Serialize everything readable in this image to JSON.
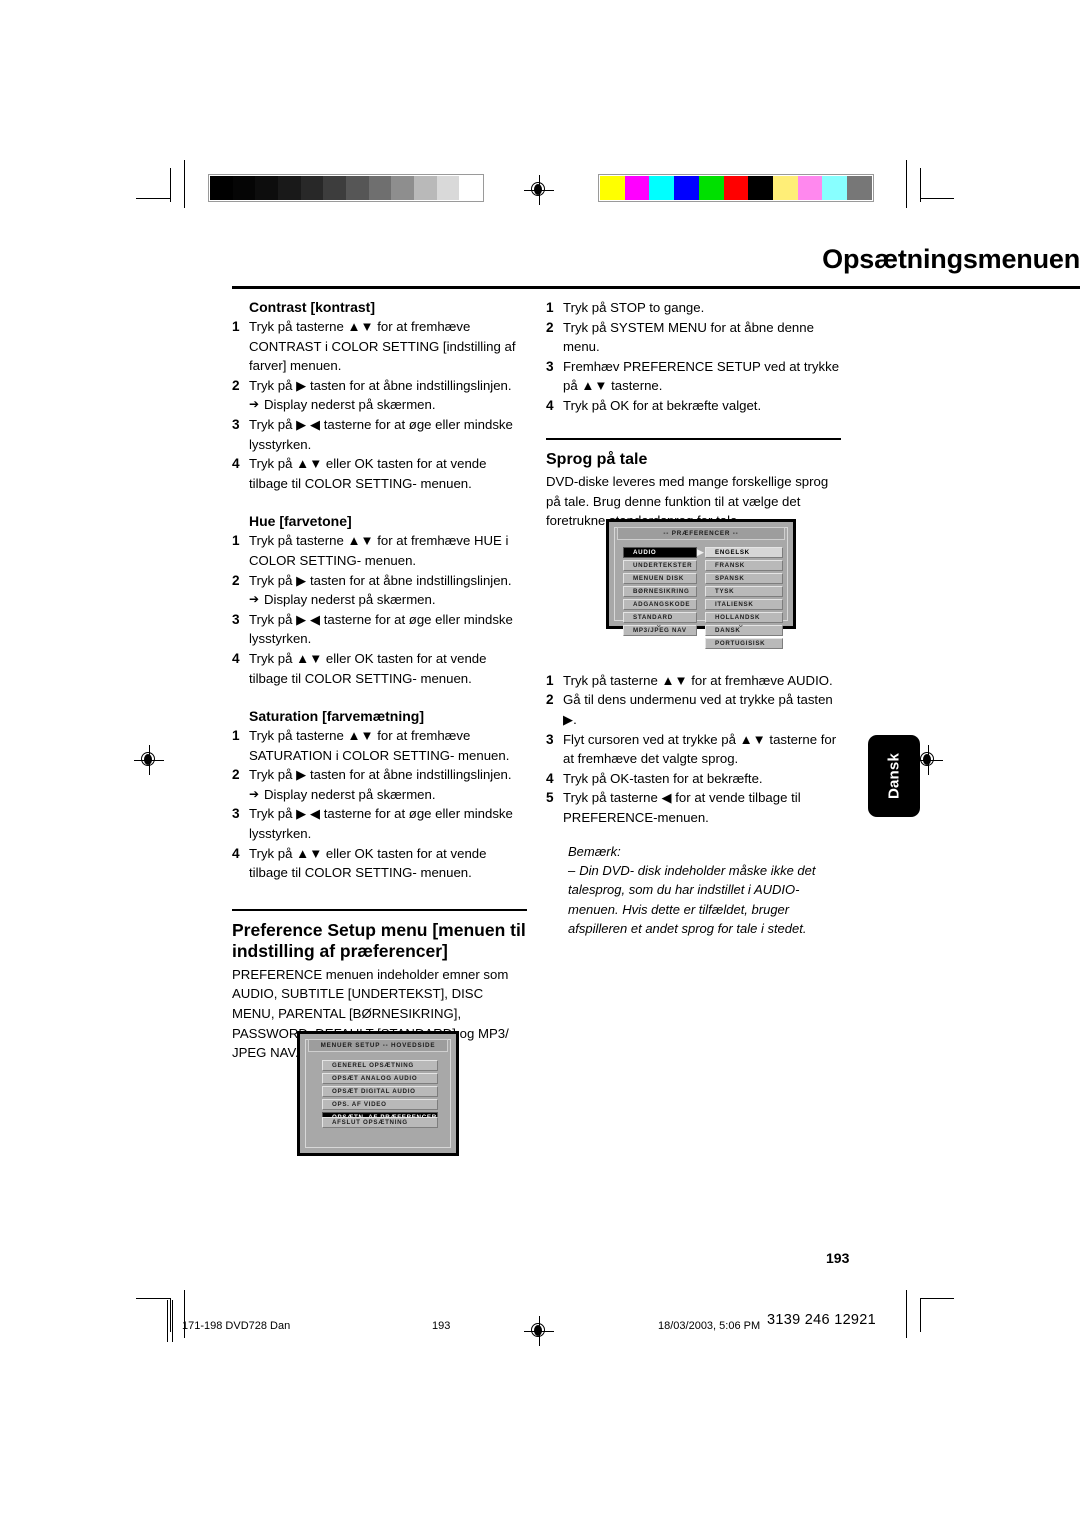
{
  "page": {
    "title": "Opsætningsmenuen",
    "number": "193",
    "side_tab": "Dansk"
  },
  "top_bars": {
    "gray_strip": [
      "#000000",
      "#050505",
      "#0d0d0d",
      "#191919",
      "#282828",
      "#3d3d3d",
      "#565656",
      "#6f6f6f",
      "#8e8e8e",
      "#b9b9b9",
      "#d9d9d9",
      "#ffffff"
    ],
    "color_strip": [
      "#ffff00",
      "#ff00ff",
      "#00ffff",
      "#0000ff",
      "#00e000",
      "#ff0000",
      "#000000",
      "#ffee77",
      "#ff88ee",
      "#88ffff",
      "#777777"
    ]
  },
  "left_column": {
    "contrast": {
      "heading": "Contrast [kontrast]",
      "steps": [
        {
          "num": "1",
          "text": "Tryk på tasterne ▲▼ for at fremhæve CONTRAST i COLOR SETTING [indstilling af farver] menuen."
        },
        {
          "num": "2",
          "text": "Tryk på ▶ tasten for at åbne indstillingslinjen.",
          "sub": "Display nederst på skærmen."
        },
        {
          "num": "3",
          "text": "Tryk på ▶ ◀ tasterne for at øge eller mindske lysstyrken."
        },
        {
          "num": "4",
          "text": "Tryk på ▲▼ eller OK tasten for at vende tilbage til COLOR SETTING- menuen."
        }
      ]
    },
    "hue": {
      "heading": "Hue [farvetone]",
      "steps": [
        {
          "num": "1",
          "text": "Tryk på tasterne ▲▼ for at fremhæve HUE i COLOR SETTING- menuen."
        },
        {
          "num": "2",
          "text": "Tryk på ▶ tasten for at åbne indstillingslinjen.",
          "sub": "Display nederst på skærmen."
        },
        {
          "num": "3",
          "text": "Tryk på ▶ ◀ tasterne for at øge eller mindske lysstyrken."
        },
        {
          "num": "4",
          "text": "Tryk på ▲▼ eller OK tasten for at vende tilbage til COLOR SETTING- menuen."
        }
      ]
    },
    "saturation": {
      "heading": "Saturation [farvemætning]",
      "steps": [
        {
          "num": "1",
          "text": "Tryk på tasterne ▲▼ for at fremhæve SATURATION i COLOR SETTING- menuen."
        },
        {
          "num": "2",
          "text": "Tryk på ▶ tasten for at åbne indstillingslinjen.",
          "sub": "Display nederst på skærmen."
        },
        {
          "num": "3",
          "text": "Tryk på ▶ ◀ tasterne for at øge eller mindske lysstyrken."
        },
        {
          "num": "4",
          "text": "Tryk på ▲▼ eller OK tasten for at vende tilbage til COLOR SETTING- menuen."
        }
      ]
    },
    "preference_setup": {
      "heading": "Preference Setup menu [menuen til indstilling af præferencer]",
      "body": "PREFERENCE menuen indeholder emner som AUDIO, SUBTITLE [UNDERTEKST], DISC MENU, PARENTAL [BØRNESIKRING], PASSWORD, DEFAULT [STANDARD] og MP3/ JPEG NAV."
    }
  },
  "right_column": {
    "setup_steps": [
      {
        "num": "1",
        "text": "Tryk på STOP to gange."
      },
      {
        "num": "2",
        "text": "Tryk på SYSTEM MENU for at åbne denne menu."
      },
      {
        "num": "3",
        "text": "Fremhæv PREFERENCE SETUP ved at trykke på ▲▼ tasterne."
      },
      {
        "num": "4",
        "text": "Tryk på OK for at bekræfte valget."
      }
    ],
    "sprog": {
      "heading": "Sprog på tale",
      "body": "DVD-diske leveres med mange forskellige sprog på tale. Brug denne funktion til at vælge det foretrukne standardsprog for tale."
    },
    "audio_steps": [
      {
        "num": "1",
        "text": "Tryk på tasterne ▲▼ for at fremhæve AUDIO."
      },
      {
        "num": "2",
        "text": "Gå til dens undermenu ved at trykke på tasten ▶."
      },
      {
        "num": "3",
        "text": "Flyt cursoren ved at trykke på ▲▼ tasterne for at fremhæve det valgte sprog."
      },
      {
        "num": "4",
        "text": "Tryk på OK-tasten for at bekræfte."
      },
      {
        "num": "5",
        "text": "Tryk på tasterne ◀ for at vende tilbage til PREFERENCE-menuen."
      }
    ],
    "note": {
      "title": "Bemærk:",
      "dash": "–",
      "text": "Din DVD- disk indeholder måske ikke det talesprog, som du har indstillet i AUDIO- menuen. Hvis dette er tilfældet, bruger afspilleren et andet sprog for tale i stedet."
    }
  },
  "osd_main_setup": {
    "title": "MENUER SETUP -- HOVEDSIDE",
    "items": [
      {
        "label": "GENEREL OPSÆTNING",
        "selected": false
      },
      {
        "label": "OPSÆT ANALOG AUDIO",
        "selected": false
      },
      {
        "label": "OPSÆT DIGITAL AUDIO",
        "selected": false
      },
      {
        "label": "OPS. AF VIDEO",
        "selected": false
      },
      {
        "label": "OPSÆTN. AF PRÆFERENCER",
        "selected": true
      }
    ],
    "exit_item": {
      "label": "AFSLUT OPSÆTNING",
      "selected": false
    }
  },
  "osd_preferences": {
    "title": "-- PRÆFERENCER --",
    "left_items": [
      {
        "label": "AUDIO",
        "selected": true
      },
      {
        "label": "UNDERTEKSTER",
        "selected": false
      },
      {
        "label": "MENUEN DISK",
        "selected": false
      },
      {
        "label": "BØRNESIKRING",
        "selected": false
      },
      {
        "label": "ADGANGSKODE",
        "selected": false
      },
      {
        "label": "STANDARD",
        "selected": false
      },
      {
        "label": "MP3/JPEG NAV",
        "selected": false
      }
    ],
    "right_items": [
      {
        "label": "ENGELSK",
        "selected": true
      },
      {
        "label": "FRANSK",
        "selected": false
      },
      {
        "label": "SPANSK",
        "selected": false
      },
      {
        "label": "TYSK",
        "selected": false
      },
      {
        "label": "ITALIENSK",
        "selected": false
      },
      {
        "label": "HOLLANDSK",
        "selected": false
      },
      {
        "label": "DANSK",
        "selected": false
      },
      {
        "label": "PORTUGISISK",
        "selected": false
      }
    ],
    "cursor_glyph": "▶",
    "chevron_glyph": "⌄"
  },
  "footer": {
    "doc_ref": "171-198 DVD728 Dan",
    "page": "193",
    "timestamp": "18/03/2003, 5:06 PM",
    "part_number": "3139 246 12921"
  }
}
